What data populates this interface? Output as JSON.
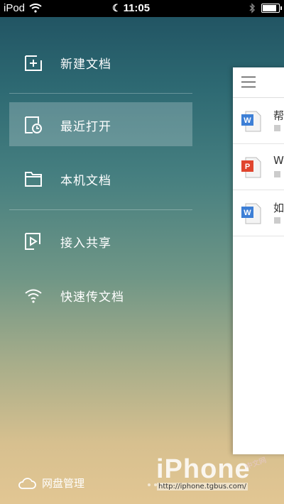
{
  "status_bar": {
    "carrier": "iPod",
    "time": "11:05"
  },
  "menu": {
    "items": [
      {
        "label": "新建文档",
        "icon": "new-document-icon"
      },
      {
        "label": "最近打开",
        "icon": "recent-clock-icon",
        "active": true
      },
      {
        "label": "本机文档",
        "icon": "folder-icon"
      },
      {
        "label": "接入共享",
        "icon": "share-play-icon"
      },
      {
        "label": "快速传文档",
        "icon": "wifi-icon"
      }
    ],
    "cloud_label": "网盘管理"
  },
  "panel": {
    "files": [
      {
        "title": "帮",
        "type": "word",
        "color": "#3d7fd6"
      },
      {
        "title": "Wh",
        "type": "ppt",
        "color": "#e0452e"
      },
      {
        "title": "如",
        "type": "word",
        "color": "#3d7fd6"
      }
    ]
  },
  "watermark": {
    "brand": "iPhone",
    "cn": "中文网",
    "url": "http://iphone.tgbus.com/"
  }
}
